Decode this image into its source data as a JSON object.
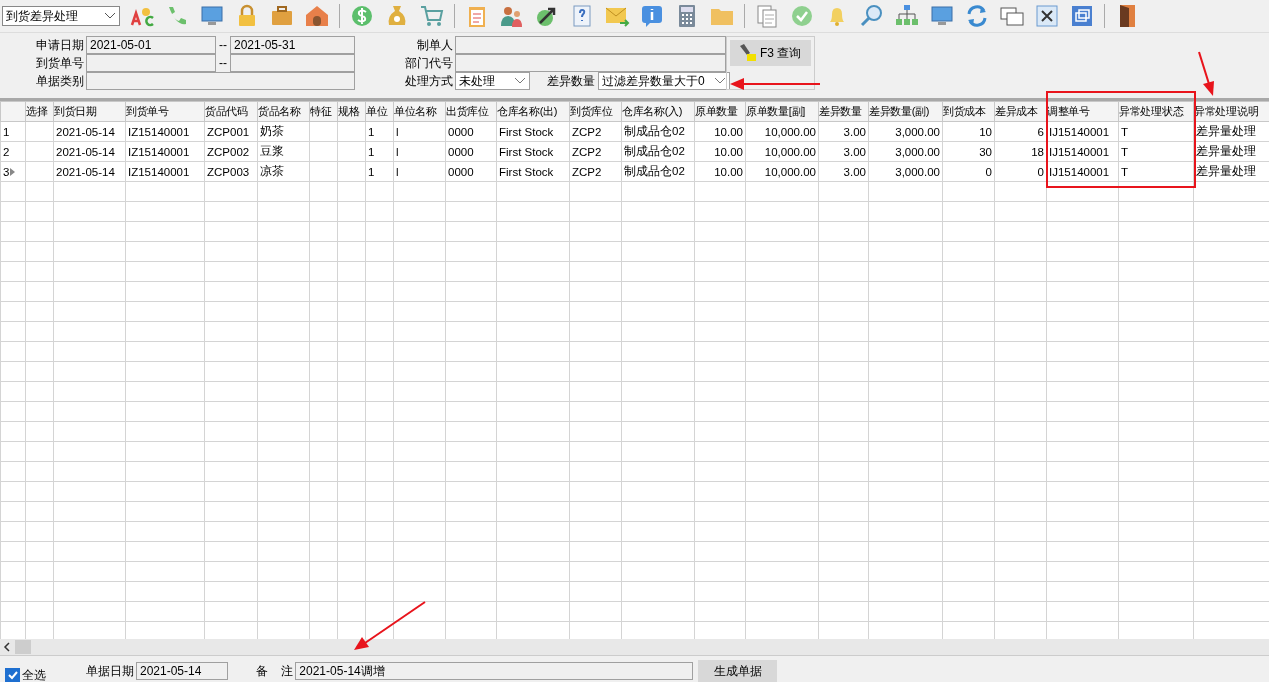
{
  "toolbar": {
    "module_select": "到货差异处理"
  },
  "filters": {
    "apply_date_label": "申请日期",
    "apply_date_from": "2021-05-01",
    "range_sep_1": "--",
    "apply_date_to": "2021-05-31",
    "arrival_no_label": "到货单号",
    "range_sep_2": "--",
    "doc_type_label": "单据类别",
    "creator_label": "制单人",
    "dept_label": "部门代号",
    "mode_label": "处理方式",
    "mode_value": "未处理",
    "diff_label": "差异数量",
    "diff_value": "过滤差异数量大于0",
    "query_button": "F3 查询"
  },
  "table": {
    "columns": [
      "选择",
      "到货日期",
      "到货单号",
      "货品代码",
      "货品名称",
      "特征",
      "规格",
      "单位",
      "单位名称",
      "出货库位",
      "仓库名称(出)",
      "到货库位",
      "仓库名称(入)",
      "原单数量",
      "原单数量[副]",
      "差异数量",
      "差异数量(副)",
      "到货成本",
      "差异成本",
      "调整单号",
      "异常处理状态",
      "异常处理说明"
    ],
    "rows": [
      {
        "current": false,
        "number": "1",
        "cells": [
          "",
          "2021-05-14",
          "IZ15140001",
          "ZCP001",
          "奶茶",
          "",
          "",
          "1",
          "l",
          "0000",
          "First Stock",
          "ZCP2",
          "制成品仓02",
          "10.00",
          "10,000.00",
          "3.00",
          "3,000.00",
          "10",
          "6",
          "IJ15140001",
          "T",
          "差异量处理"
        ]
      },
      {
        "current": false,
        "number": "2",
        "cells": [
          "",
          "2021-05-14",
          "IZ15140001",
          "ZCP002",
          "豆浆",
          "",
          "",
          "1",
          "l",
          "0000",
          "First Stock",
          "ZCP2",
          "制成品仓02",
          "10.00",
          "10,000.00",
          "3.00",
          "3,000.00",
          "30",
          "18",
          "IJ15140001",
          "T",
          "差异量处理"
        ]
      },
      {
        "current": true,
        "number": "3",
        "cells": [
          "",
          "2021-05-14",
          "IZ15140001",
          "ZCP003",
          "凉茶",
          "",
          "",
          "1",
          "l",
          "0000",
          "First Stock",
          "ZCP2",
          "制成品仓02",
          "10.00",
          "10,000.00",
          "3.00",
          "3,000.00",
          "0",
          "0",
          "IJ15140001",
          "T",
          "差异量处理"
        ]
      }
    ]
  },
  "footer": {
    "select_all": {
      "label": "全选",
      "checked": true
    },
    "doc_date_label": "单据日期",
    "doc_date": "2021-05-14",
    "remark_label": "备 注",
    "remark": "2021-05-14调增",
    "generate_button": "生成单据"
  }
}
